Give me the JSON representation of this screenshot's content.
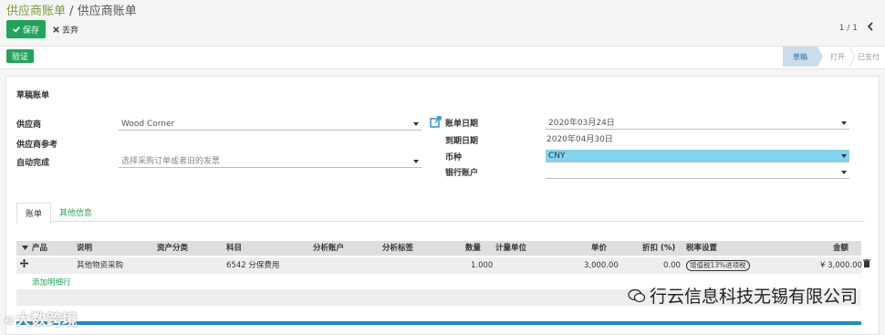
{
  "breadcrumb": {
    "parent": "供应商账单",
    "separator": "/",
    "current": "供应商账单"
  },
  "toolbar": {
    "save_label": "保存",
    "discard_label": "丢弃"
  },
  "pager": {
    "value": "1 / 1",
    "prev_icon": "chevron-left-icon"
  },
  "statusbar": {
    "validate_label": "验证",
    "stages": [
      "草稿",
      "打开",
      "已支付"
    ],
    "active_stage": "草稿"
  },
  "form": {
    "title": "草稿账单",
    "vendor_label": "供应商",
    "vendor_value": "Wood Corner",
    "vendor_ref_label": "供应商参考",
    "autocomplete_label": "自动完成",
    "autocomplete_placeholder": "选择采购订单或者旧的发票",
    "bill_date_label": "账单日期",
    "bill_date_value": "2020年03月24日",
    "due_date_label": "到期日期",
    "due_date_value": "2020年04月30日",
    "currency_label": "币种",
    "currency_value": "CNY",
    "bank_label": "银行账户",
    "bank_value": "",
    "external_link_icon": "external-link-icon"
  },
  "tabs": [
    {
      "label": "账单",
      "active": true
    },
    {
      "label": "其他信息",
      "active": false
    }
  ],
  "table": {
    "headers": {
      "product": "产品",
      "desc": "说明",
      "asset": "资产分类",
      "account": "科目",
      "analytic_account": "分析账户",
      "analytic_tags": "分析标签",
      "qty": "数量",
      "uom": "计量单位",
      "price": "单价",
      "discount": "折扣 (%)",
      "taxes": "税率设置",
      "amount": "金额"
    },
    "rows": [
      {
        "product": "",
        "desc": "其他物资采购",
        "asset": "",
        "account": "6542 分保费用",
        "analytic_account": "",
        "analytic_tags": "",
        "qty": "1.000",
        "uom": "",
        "price": "3,000.00",
        "discount": "0.00",
        "tax": "增值税13%进项税",
        "amount": "¥ 3,000.00"
      }
    ],
    "add_line_label": "添加明细行"
  },
  "watermarks": {
    "right": "行云信息科技无锡有限公司",
    "left": "大数跨境"
  },
  "colors": {
    "primary": "#21a45a",
    "link": "#7c9a3a",
    "highlight": "#7fd5ef",
    "accent_bar": "#1b8ec7"
  }
}
